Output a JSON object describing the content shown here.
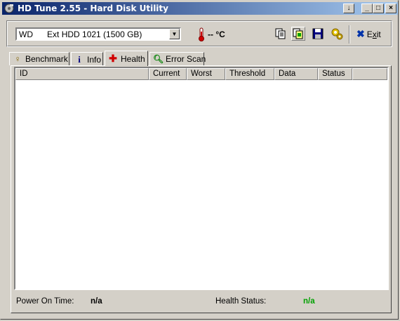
{
  "window": {
    "title": "HD Tune 2.55 - Hard Disk Utility",
    "controls": {
      "down": "↓",
      "minimize": "_",
      "maximize": "□",
      "close": "×"
    }
  },
  "toolbar": {
    "drive_brand": "WD",
    "drive_model": "Ext HDD 1021 (1500 GB)",
    "temperature": "-- °C",
    "exit_label_prefix": "E",
    "exit_label_underlined": "x",
    "exit_label_suffix": "it",
    "icons": [
      "copy-icon",
      "copy-all-icon",
      "save-icon",
      "options-icon",
      "exit-icon"
    ]
  },
  "tabs": [
    {
      "label": "Benchmark",
      "icon": "benchmark-icon"
    },
    {
      "label": "Info",
      "icon": "info-icon"
    },
    {
      "label": "Health",
      "icon": "health-icon",
      "active": true
    },
    {
      "label": "Error Scan",
      "icon": "error-scan-icon"
    }
  ],
  "health_table": {
    "columns": [
      "ID",
      "Current",
      "Worst",
      "Threshold",
      "Data",
      "Status"
    ],
    "rows": []
  },
  "footer": {
    "power_on_time_label": "Power On Time:",
    "power_on_time_value": "n/a",
    "health_status_label": "Health Status:",
    "health_status_value": "n/a",
    "health_status_color": "#00a000"
  }
}
